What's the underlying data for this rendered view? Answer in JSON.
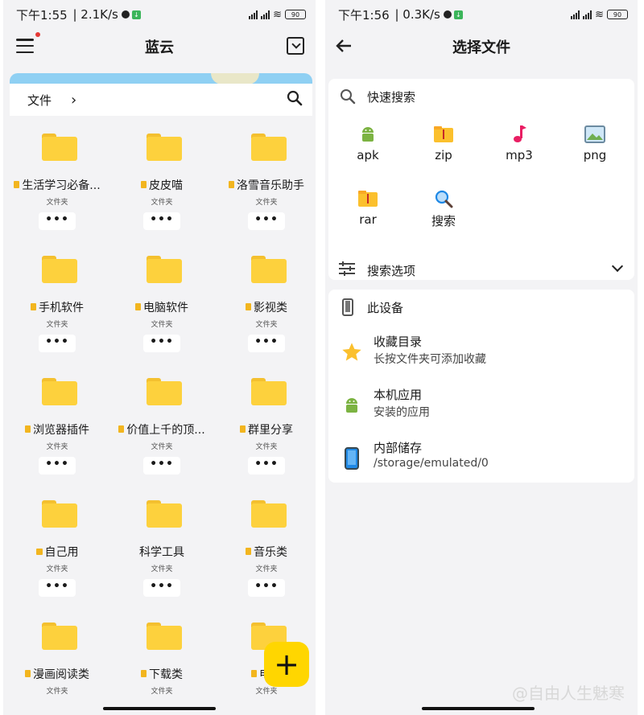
{
  "left": {
    "status": {
      "time": "下午1:55",
      "speed": "2.1K/s",
      "battery": "90"
    },
    "title": "蓝云",
    "breadcrumb": "文件",
    "folders": [
      {
        "name": "生活学习必备...",
        "type": "文件夹",
        "more": "•••",
        "icon": "doc"
      },
      {
        "name": "皮皮喵",
        "type": "文件夹",
        "more": "•••",
        "icon": "doc"
      },
      {
        "name": "洛雪音乐助手",
        "type": "文件夹",
        "more": "•••",
        "icon": "doc"
      },
      {
        "name": "手机软件",
        "type": "文件夹",
        "more": "•••",
        "icon": "doc"
      },
      {
        "name": "电脑软件",
        "type": "文件夹",
        "more": "•••",
        "icon": "doc"
      },
      {
        "name": "影视类",
        "type": "文件夹",
        "more": "•••",
        "icon": "doc"
      },
      {
        "name": "浏览器插件",
        "type": "文件夹",
        "more": "•••",
        "icon": "doc"
      },
      {
        "name": "价值上千的顶...",
        "type": "文件夹",
        "more": "•••",
        "icon": "doc"
      },
      {
        "name": "群里分享",
        "type": "文件夹",
        "more": "•••",
        "icon": "doc"
      },
      {
        "name": "自己用",
        "type": "文件夹",
        "more": "•••",
        "icon": "lock"
      },
      {
        "name": "科学工具",
        "type": "文件夹",
        "more": "•••",
        "icon": "none"
      },
      {
        "name": "音乐类",
        "type": "文件夹",
        "more": "•••",
        "icon": "doc"
      },
      {
        "name": "漫画阅读类",
        "type": "文件夹",
        "more": "",
        "icon": "doc"
      },
      {
        "name": "下载类",
        "type": "文件夹",
        "more": "",
        "icon": "doc"
      },
      {
        "name": "电视",
        "type": "文件夹",
        "more": "",
        "icon": "doc"
      }
    ],
    "fab": "+"
  },
  "right": {
    "status": {
      "time": "下午1:56",
      "speed": "0.3K/s",
      "battery": "90"
    },
    "title": "选择文件",
    "quick_search": {
      "header": "快速搜索",
      "items": [
        {
          "label": "apk",
          "icon": "android-icon"
        },
        {
          "label": "zip",
          "icon": "zip-icon"
        },
        {
          "label": "mp3",
          "icon": "music-note-icon"
        },
        {
          "label": "png",
          "icon": "image-icon"
        },
        {
          "label": "rar",
          "icon": "rar-icon"
        },
        {
          "label": "搜索",
          "icon": "search-icon"
        }
      ],
      "options": "搜索选项"
    },
    "device": {
      "header": "此设备",
      "items": [
        {
          "title": "收藏目录",
          "subtitle": "长按文件夹可添加收藏",
          "icon": "star-icon"
        },
        {
          "title": "本机应用",
          "subtitle": "安装的应用",
          "icon": "android-icon"
        },
        {
          "title": "内部储存",
          "subtitle": "/storage/emulated/0",
          "icon": "phone-icon"
        }
      ]
    }
  },
  "watermark": "@自由人生魅寒",
  "colors": {
    "folder": "#fdd13d",
    "fab": "#ffd600",
    "android": "#7cb342",
    "music": "#e91e63",
    "star": "#fbc02d"
  }
}
